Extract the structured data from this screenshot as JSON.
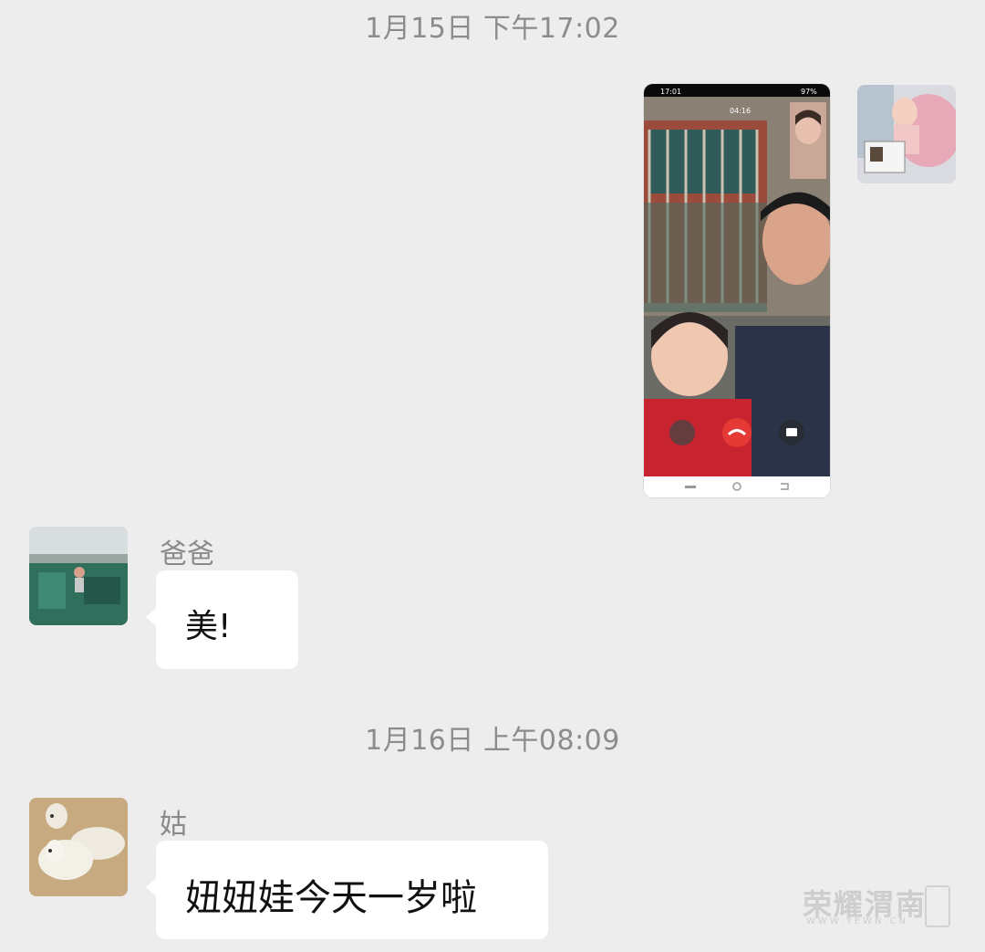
{
  "timestamps": {
    "first": "1月15日 下午17:02",
    "second": "1月16日 上午08:09"
  },
  "shared_screenshot": {
    "status_time": "17:01",
    "battery": "97%",
    "call_timer": "04:16"
  },
  "messages": [
    {
      "sender": "爸爸",
      "text": "美!"
    },
    {
      "sender": "姑",
      "text": "妞妞娃今天一岁啦"
    }
  ],
  "watermark": {
    "brand": "荣耀渭南",
    "site": "WWW.YEWN.CN"
  }
}
